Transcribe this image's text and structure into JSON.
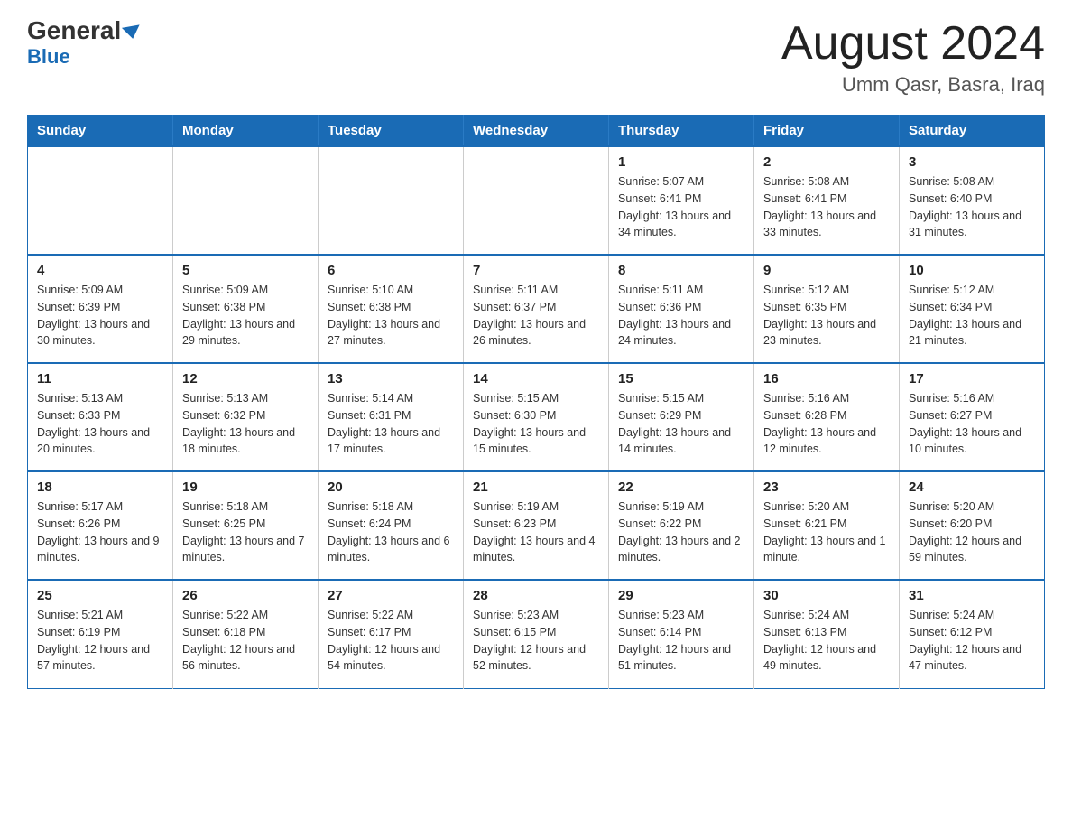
{
  "header": {
    "logo_line1": "General",
    "logo_line2": "Blue",
    "month_title": "August 2024",
    "location": "Umm Qasr, Basra, Iraq"
  },
  "weekdays": [
    "Sunday",
    "Monday",
    "Tuesday",
    "Wednesday",
    "Thursday",
    "Friday",
    "Saturday"
  ],
  "weeks": [
    [
      {
        "day": "",
        "info": ""
      },
      {
        "day": "",
        "info": ""
      },
      {
        "day": "",
        "info": ""
      },
      {
        "day": "",
        "info": ""
      },
      {
        "day": "1",
        "info": "Sunrise: 5:07 AM\nSunset: 6:41 PM\nDaylight: 13 hours and 34 minutes."
      },
      {
        "day": "2",
        "info": "Sunrise: 5:08 AM\nSunset: 6:41 PM\nDaylight: 13 hours and 33 minutes."
      },
      {
        "day": "3",
        "info": "Sunrise: 5:08 AM\nSunset: 6:40 PM\nDaylight: 13 hours and 31 minutes."
      }
    ],
    [
      {
        "day": "4",
        "info": "Sunrise: 5:09 AM\nSunset: 6:39 PM\nDaylight: 13 hours and 30 minutes."
      },
      {
        "day": "5",
        "info": "Sunrise: 5:09 AM\nSunset: 6:38 PM\nDaylight: 13 hours and 29 minutes."
      },
      {
        "day": "6",
        "info": "Sunrise: 5:10 AM\nSunset: 6:38 PM\nDaylight: 13 hours and 27 minutes."
      },
      {
        "day": "7",
        "info": "Sunrise: 5:11 AM\nSunset: 6:37 PM\nDaylight: 13 hours and 26 minutes."
      },
      {
        "day": "8",
        "info": "Sunrise: 5:11 AM\nSunset: 6:36 PM\nDaylight: 13 hours and 24 minutes."
      },
      {
        "day": "9",
        "info": "Sunrise: 5:12 AM\nSunset: 6:35 PM\nDaylight: 13 hours and 23 minutes."
      },
      {
        "day": "10",
        "info": "Sunrise: 5:12 AM\nSunset: 6:34 PM\nDaylight: 13 hours and 21 minutes."
      }
    ],
    [
      {
        "day": "11",
        "info": "Sunrise: 5:13 AM\nSunset: 6:33 PM\nDaylight: 13 hours and 20 minutes."
      },
      {
        "day": "12",
        "info": "Sunrise: 5:13 AM\nSunset: 6:32 PM\nDaylight: 13 hours and 18 minutes."
      },
      {
        "day": "13",
        "info": "Sunrise: 5:14 AM\nSunset: 6:31 PM\nDaylight: 13 hours and 17 minutes."
      },
      {
        "day": "14",
        "info": "Sunrise: 5:15 AM\nSunset: 6:30 PM\nDaylight: 13 hours and 15 minutes."
      },
      {
        "day": "15",
        "info": "Sunrise: 5:15 AM\nSunset: 6:29 PM\nDaylight: 13 hours and 14 minutes."
      },
      {
        "day": "16",
        "info": "Sunrise: 5:16 AM\nSunset: 6:28 PM\nDaylight: 13 hours and 12 minutes."
      },
      {
        "day": "17",
        "info": "Sunrise: 5:16 AM\nSunset: 6:27 PM\nDaylight: 13 hours and 10 minutes."
      }
    ],
    [
      {
        "day": "18",
        "info": "Sunrise: 5:17 AM\nSunset: 6:26 PM\nDaylight: 13 hours and 9 minutes."
      },
      {
        "day": "19",
        "info": "Sunrise: 5:18 AM\nSunset: 6:25 PM\nDaylight: 13 hours and 7 minutes."
      },
      {
        "day": "20",
        "info": "Sunrise: 5:18 AM\nSunset: 6:24 PM\nDaylight: 13 hours and 6 minutes."
      },
      {
        "day": "21",
        "info": "Sunrise: 5:19 AM\nSunset: 6:23 PM\nDaylight: 13 hours and 4 minutes."
      },
      {
        "day": "22",
        "info": "Sunrise: 5:19 AM\nSunset: 6:22 PM\nDaylight: 13 hours and 2 minutes."
      },
      {
        "day": "23",
        "info": "Sunrise: 5:20 AM\nSunset: 6:21 PM\nDaylight: 13 hours and 1 minute."
      },
      {
        "day": "24",
        "info": "Sunrise: 5:20 AM\nSunset: 6:20 PM\nDaylight: 12 hours and 59 minutes."
      }
    ],
    [
      {
        "day": "25",
        "info": "Sunrise: 5:21 AM\nSunset: 6:19 PM\nDaylight: 12 hours and 57 minutes."
      },
      {
        "day": "26",
        "info": "Sunrise: 5:22 AM\nSunset: 6:18 PM\nDaylight: 12 hours and 56 minutes."
      },
      {
        "day": "27",
        "info": "Sunrise: 5:22 AM\nSunset: 6:17 PM\nDaylight: 12 hours and 54 minutes."
      },
      {
        "day": "28",
        "info": "Sunrise: 5:23 AM\nSunset: 6:15 PM\nDaylight: 12 hours and 52 minutes."
      },
      {
        "day": "29",
        "info": "Sunrise: 5:23 AM\nSunset: 6:14 PM\nDaylight: 12 hours and 51 minutes."
      },
      {
        "day": "30",
        "info": "Sunrise: 5:24 AM\nSunset: 6:13 PM\nDaylight: 12 hours and 49 minutes."
      },
      {
        "day": "31",
        "info": "Sunrise: 5:24 AM\nSunset: 6:12 PM\nDaylight: 12 hours and 47 minutes."
      }
    ]
  ]
}
